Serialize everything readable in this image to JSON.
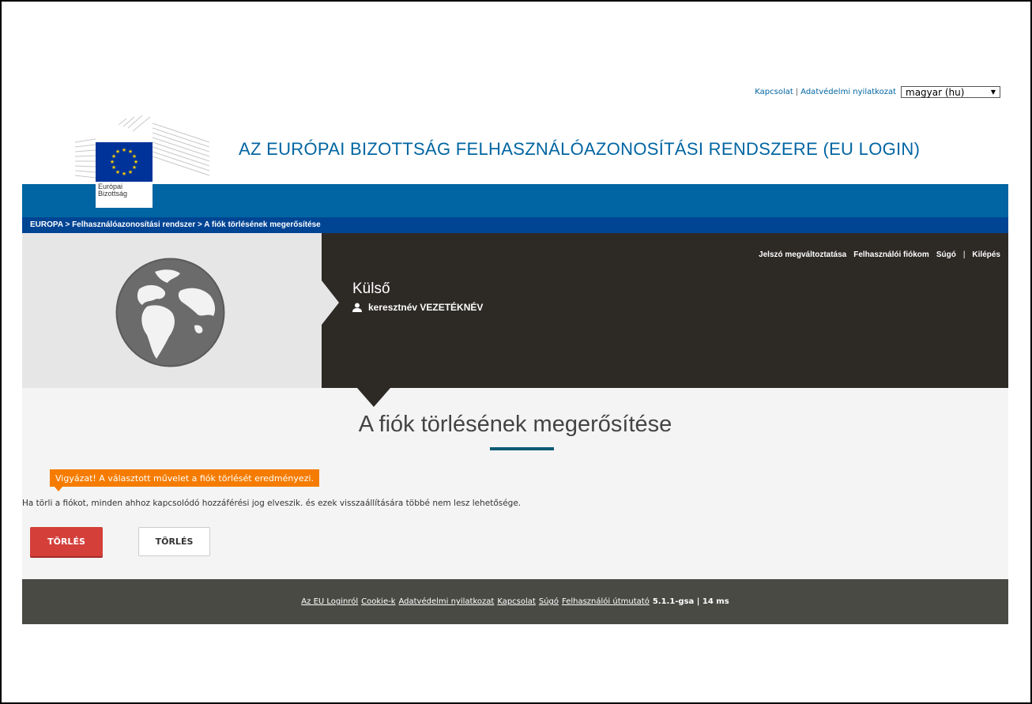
{
  "toplinks": {
    "contact": "Kapcsolat",
    "privacy": "Adatvédelmi nyilatkozat",
    "language_selected": "magyar (hu)"
  },
  "header": {
    "title": "AZ EURÓPAI BIZOTTSÁG FELHASZNÁLÓAZONOSÍTÁSI RENDSZERE (EU LOGIN)",
    "logo_text_line1": "Európai",
    "logo_text_line2": "Bizottság"
  },
  "breadcrumb": {
    "items": [
      "EUROPA",
      "Felhasználóazonosítási rendszer",
      "A fiók törlésének megerősítése"
    ]
  },
  "hero": {
    "nav": [
      "Jelszó megváltoztatása",
      "Felhasználói fiókom",
      "Súgó",
      "Kilépés"
    ],
    "title": "Külső",
    "user": "keresztnév VEZETÉKNÉV"
  },
  "main": {
    "title": "A fiók törlésének megerősítése",
    "warning": "Vigyázat! A választott művelet a fiók törlését eredményezi.",
    "body": "Ha törli a fiókot, minden ahhoz kapcsolódó hozzáférési jog elveszik. és ezek visszaállítására többé nem lesz lehetősége.",
    "primary_button": "TÖRLÉS",
    "secondary_button": "TÖRLÉS"
  },
  "footer": {
    "links": [
      "Az EU Loginról",
      "Cookie-k",
      "Adatvédelmi nyilatkozat",
      "Kapcsolat",
      "Súgó",
      "Felhasználói útmutató"
    ],
    "version": "5.1.1-gsa | 14 ms"
  },
  "colors": {
    "brand_blue": "#0065a2",
    "dark_panel": "#2d2a26",
    "warning_orange": "#f57c00",
    "danger_red": "#d43f3a"
  }
}
